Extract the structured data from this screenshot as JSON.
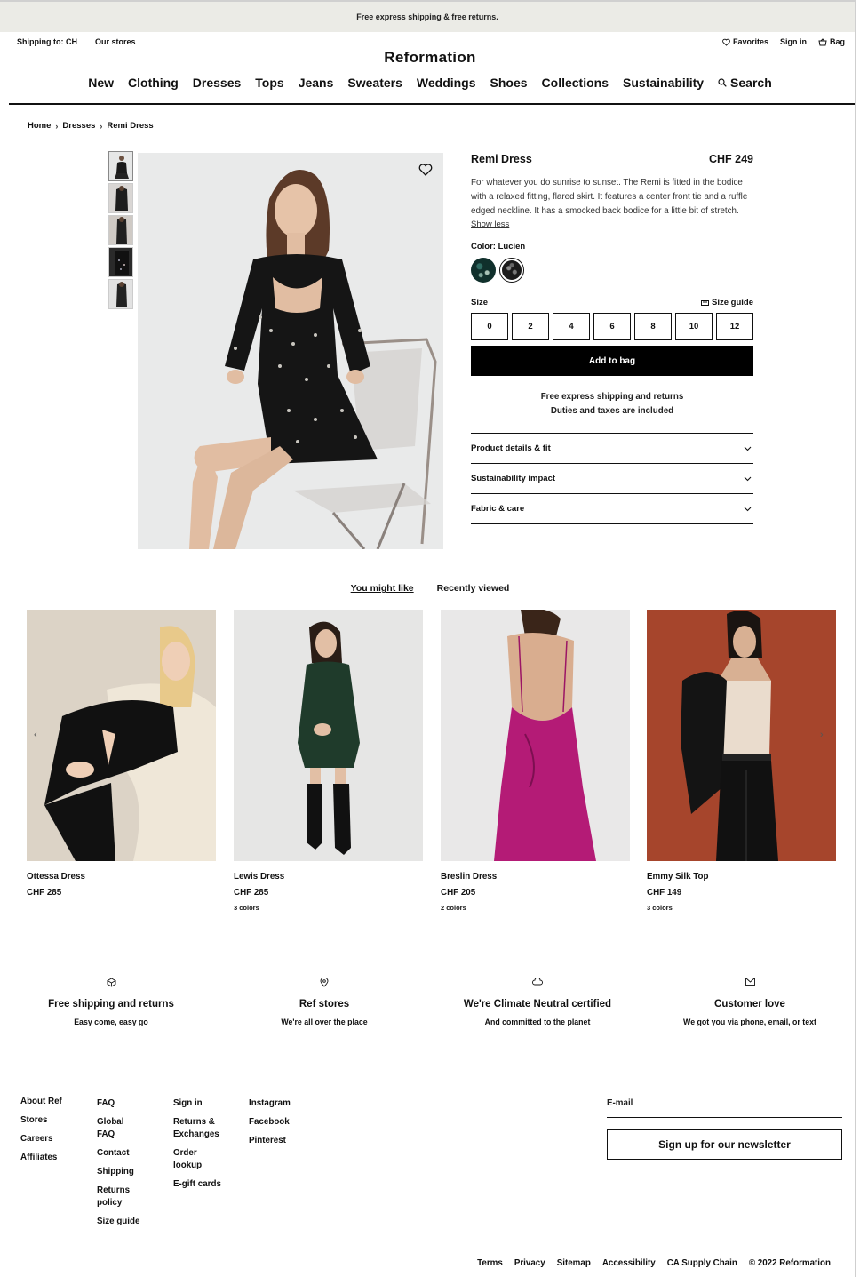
{
  "promo": "Free express shipping & free returns.",
  "topbar": {
    "shipping_to": "Shipping to: CH",
    "our_stores": "Our stores",
    "favorites": "Favorites",
    "sign_in": "Sign in",
    "bag": "Bag"
  },
  "logo": "Reformation",
  "nav": [
    "New",
    "Clothing",
    "Dresses",
    "Tops",
    "Jeans",
    "Sweaters",
    "Weddings",
    "Shoes",
    "Collections",
    "Sustainability",
    "Search"
  ],
  "breadcrumb": [
    "Home",
    "Dresses",
    "Remi Dress"
  ],
  "product": {
    "name": "Remi Dress",
    "price": "CHF 249",
    "description": "For whatever you do sunrise to sunset. The Remi is fitted in the bodice with a relaxed fitting, flared skirt. It features a center front tie and a ruffle edged neckline. It has a smocked back bodice for a little bit of stretch.",
    "show_less": "Show less",
    "color_label": "Color: Lucien",
    "size_label": "Size",
    "size_guide": "Size guide",
    "sizes": [
      "0",
      "2",
      "4",
      "6",
      "8",
      "10",
      "12"
    ],
    "add_to_bag": "Add to bag",
    "ship_line1": "Free express shipping and returns",
    "ship_line2": "Duties and taxes are included",
    "accordion": [
      "Product details & fit",
      "Sustainability impact",
      "Fabric & care"
    ]
  },
  "tabs": [
    "You might like",
    "Recently viewed"
  ],
  "recommendations": [
    {
      "name": "Ottessa Dress",
      "price": "CHF 285",
      "colors": ""
    },
    {
      "name": "Lewis Dress",
      "price": "CHF 285",
      "colors": "3 colors"
    },
    {
      "name": "Breslin Dress",
      "price": "CHF 205",
      "colors": "2 colors"
    },
    {
      "name": "Emmy Silk Top",
      "price": "CHF 149",
      "colors": "3 colors"
    }
  ],
  "features": [
    {
      "title": "Free shipping and returns",
      "subtitle": "Easy come, easy go",
      "icon": "box-icon"
    },
    {
      "title": "Ref stores",
      "subtitle": "We're all over the place",
      "icon": "location-pin-icon"
    },
    {
      "title": "We're Climate Neutral certified",
      "subtitle": "And committed to the planet",
      "icon": "cloud-icon"
    },
    {
      "title": "Customer love",
      "subtitle": "We got you via phone, email, or text",
      "icon": "envelope-icon"
    }
  ],
  "footer": {
    "col1": [
      "About Ref",
      "Stores",
      "Careers",
      "Affiliates"
    ],
    "col2": [
      "FAQ",
      "Global FAQ",
      "Contact",
      "Shipping",
      "Returns policy",
      "Size guide"
    ],
    "col3": [
      "Sign in",
      "Returns & Exchanges",
      "Order lookup",
      "E-gift cards"
    ],
    "col4": [
      "Instagram",
      "Facebook",
      "Pinterest"
    ],
    "email_label": "E-mail",
    "newsletter": "Sign up for our newsletter",
    "legal": [
      "Terms",
      "Privacy",
      "Sitemap",
      "Accessibility",
      "CA Supply Chain",
      "© 2022 Reformation"
    ]
  },
  "colors": {
    "accent": "#000000",
    "banner_bg": "#ebebe6"
  }
}
